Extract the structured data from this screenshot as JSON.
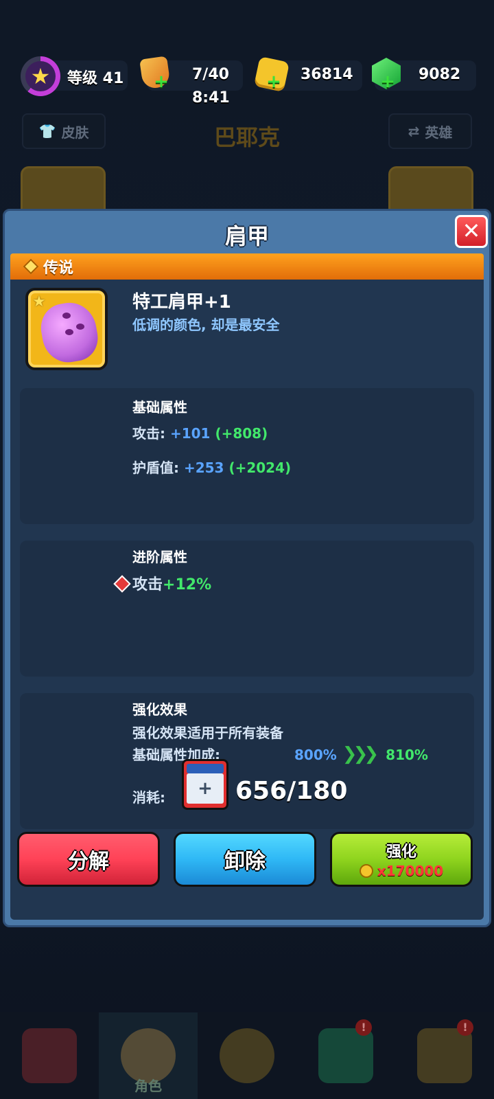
{
  "topbar": {
    "level_label": "等级 41",
    "energy_value": "7/40",
    "energy_timer": "8:41",
    "coins": "36814",
    "gems": "9082"
  },
  "background": {
    "skin_button": "皮肤",
    "hero_name": "巴耶克",
    "hero_button": "英雄"
  },
  "modal": {
    "title": "肩甲",
    "close_symbol": "✕",
    "rarity": "传说",
    "item_name": "特工肩甲+1",
    "item_desc": "低调的颜色, 却是最安全",
    "base": {
      "title": "基础属性",
      "attack_label": "攻击: ",
      "attack_value": "+101",
      "attack_bonus": "(+808)",
      "shield_label": "护盾值: ",
      "shield_value": "+253",
      "shield_bonus": "(+2024)"
    },
    "advanced": {
      "title": "进阶属性",
      "line_label": "攻击",
      "line_value": "+12%"
    },
    "enhance": {
      "title": "强化效果",
      "desc": "强化效果适用于所有装备",
      "bonus_label": "基础属性加成:",
      "from": "800%",
      "arrows": "❯❯❯",
      "to": "810%",
      "cost_label": "消耗:",
      "cost_value": "656/180"
    },
    "buttons": {
      "dismantle": "分解",
      "unequip": "卸除",
      "upgrade": "强化",
      "upgrade_cost": "x170000"
    }
  },
  "nav": {
    "active_label": "角色",
    "badge": "!"
  },
  "colors": {
    "modal_frame": "#4b79a8",
    "rarity_orange": "#ff9a1a",
    "stat_blue": "#5aa4ff",
    "stat_green": "#42e86b",
    "btn_red": "#ff4257",
    "btn_blue": "#2fb8f5",
    "btn_green": "#8fd41e"
  }
}
